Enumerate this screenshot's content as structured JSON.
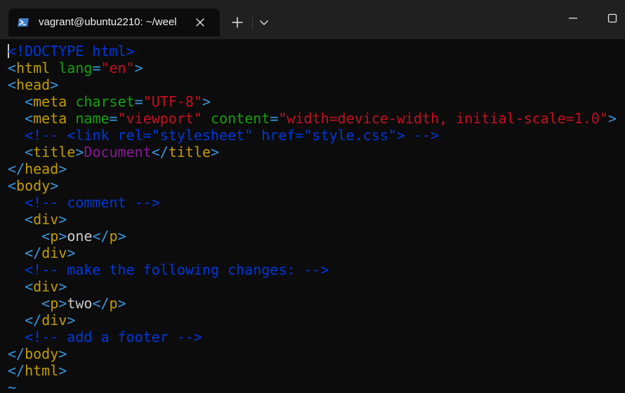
{
  "tab": {
    "title": "vagrant@ubuntu2210: ~/weel",
    "icon": "powershell-icon"
  },
  "controls": {
    "new_tab_icon": "plus-icon",
    "dropdown_icon": "chevron-down-icon",
    "minimize_icon": "minimize-icon",
    "maximize_icon": "maximize-icon",
    "close_tab_icon": "close-icon"
  },
  "colors": {
    "background": "#0c0c0c",
    "titlebar": "#202020",
    "tag_bracket": "#3a96dd",
    "tag_name": "#c19c00",
    "attribute": "#13a10e",
    "string": "#c50f1f",
    "comment": "#0037da",
    "title_text": "#881798",
    "plain_text": "#cccccc"
  },
  "editor": {
    "lines": [
      [
        {
          "text": "<!DOCTYPE html>",
          "cls": "comment"
        }
      ],
      [
        {
          "text": "<",
          "cls": "tag"
        },
        {
          "text": "html",
          "cls": "tagname"
        },
        {
          "text": " ",
          "cls": "text"
        },
        {
          "text": "lang",
          "cls": "attr"
        },
        {
          "text": "=",
          "cls": "tag"
        },
        {
          "text": "\"en\"",
          "cls": "str"
        },
        {
          "text": ">",
          "cls": "tag"
        }
      ],
      [
        {
          "text": "<",
          "cls": "tag"
        },
        {
          "text": "head",
          "cls": "tagname"
        },
        {
          "text": ">",
          "cls": "tag"
        }
      ],
      [
        {
          "text": "  ",
          "cls": "text"
        },
        {
          "text": "<",
          "cls": "tag"
        },
        {
          "text": "meta",
          "cls": "tagname"
        },
        {
          "text": " ",
          "cls": "text"
        },
        {
          "text": "charset",
          "cls": "attr"
        },
        {
          "text": "=",
          "cls": "tag"
        },
        {
          "text": "\"UTF-8\"",
          "cls": "str"
        },
        {
          "text": ">",
          "cls": "tag"
        }
      ],
      [
        {
          "text": "  ",
          "cls": "text"
        },
        {
          "text": "<",
          "cls": "tag"
        },
        {
          "text": "meta",
          "cls": "tagname"
        },
        {
          "text": " ",
          "cls": "text"
        },
        {
          "text": "name",
          "cls": "attr"
        },
        {
          "text": "=",
          "cls": "tag"
        },
        {
          "text": "\"viewport\"",
          "cls": "str"
        },
        {
          "text": " ",
          "cls": "text"
        },
        {
          "text": "content",
          "cls": "attr"
        },
        {
          "text": "=",
          "cls": "tag"
        },
        {
          "text": "\"width=device-width, initial-scale=1.0\"",
          "cls": "str"
        },
        {
          "text": ">",
          "cls": "tag"
        }
      ],
      [
        {
          "text": "  ",
          "cls": "text"
        },
        {
          "text": "<!-- <link rel=\"stylesheet\" href=\"style.css\"> -->",
          "cls": "comment"
        }
      ],
      [
        {
          "text": "  ",
          "cls": "text"
        },
        {
          "text": "<",
          "cls": "tag"
        },
        {
          "text": "title",
          "cls": "tagname"
        },
        {
          "text": ">",
          "cls": "tag"
        },
        {
          "text": "Document",
          "cls": "titletext"
        },
        {
          "text": "</",
          "cls": "tag"
        },
        {
          "text": "title",
          "cls": "tagname"
        },
        {
          "text": ">",
          "cls": "tag"
        }
      ],
      [
        {
          "text": "</",
          "cls": "tag"
        },
        {
          "text": "head",
          "cls": "tagname"
        },
        {
          "text": ">",
          "cls": "tag"
        }
      ],
      [
        {
          "text": "<",
          "cls": "tag"
        },
        {
          "text": "body",
          "cls": "tagname"
        },
        {
          "text": ">",
          "cls": "tag"
        }
      ],
      [
        {
          "text": "  ",
          "cls": "text"
        },
        {
          "text": "<!-- comment -->",
          "cls": "comment"
        }
      ],
      [
        {
          "text": "  ",
          "cls": "text"
        },
        {
          "text": "<",
          "cls": "tag"
        },
        {
          "text": "div",
          "cls": "tagname"
        },
        {
          "text": ">",
          "cls": "tag"
        }
      ],
      [
        {
          "text": "    ",
          "cls": "text"
        },
        {
          "text": "<",
          "cls": "tag"
        },
        {
          "text": "p",
          "cls": "tagname"
        },
        {
          "text": ">",
          "cls": "tag"
        },
        {
          "text": "one",
          "cls": "text"
        },
        {
          "text": "</",
          "cls": "tag"
        },
        {
          "text": "p",
          "cls": "tagname"
        },
        {
          "text": ">",
          "cls": "tag"
        }
      ],
      [
        {
          "text": "  ",
          "cls": "text"
        },
        {
          "text": "</",
          "cls": "tag"
        },
        {
          "text": "div",
          "cls": "tagname"
        },
        {
          "text": ">",
          "cls": "tag"
        }
      ],
      [
        {
          "text": "  ",
          "cls": "text"
        },
        {
          "text": "<!-- make the following changes: -->",
          "cls": "comment"
        }
      ],
      [
        {
          "text": "  ",
          "cls": "text"
        },
        {
          "text": "<",
          "cls": "tag"
        },
        {
          "text": "div",
          "cls": "tagname"
        },
        {
          "text": ">",
          "cls": "tag"
        }
      ],
      [
        {
          "text": "    ",
          "cls": "text"
        },
        {
          "text": "<",
          "cls": "tag"
        },
        {
          "text": "p",
          "cls": "tagname"
        },
        {
          "text": ">",
          "cls": "tag"
        },
        {
          "text": "two",
          "cls": "text"
        },
        {
          "text": "</",
          "cls": "tag"
        },
        {
          "text": "p",
          "cls": "tagname"
        },
        {
          "text": ">",
          "cls": "tag"
        }
      ],
      [
        {
          "text": "  ",
          "cls": "text"
        },
        {
          "text": "</",
          "cls": "tag"
        },
        {
          "text": "div",
          "cls": "tagname"
        },
        {
          "text": ">",
          "cls": "tag"
        }
      ],
      [
        {
          "text": "  ",
          "cls": "text"
        },
        {
          "text": "<!-- add a footer -->",
          "cls": "comment"
        }
      ],
      [
        {
          "text": "</",
          "cls": "tag"
        },
        {
          "text": "body",
          "cls": "tagname"
        },
        {
          "text": ">",
          "cls": "tag"
        }
      ],
      [
        {
          "text": "</",
          "cls": "tag"
        },
        {
          "text": "html",
          "cls": "tagname"
        },
        {
          "text": ">",
          "cls": "tag"
        }
      ],
      [
        {
          "text": "~",
          "cls": "tilde"
        }
      ]
    ]
  }
}
